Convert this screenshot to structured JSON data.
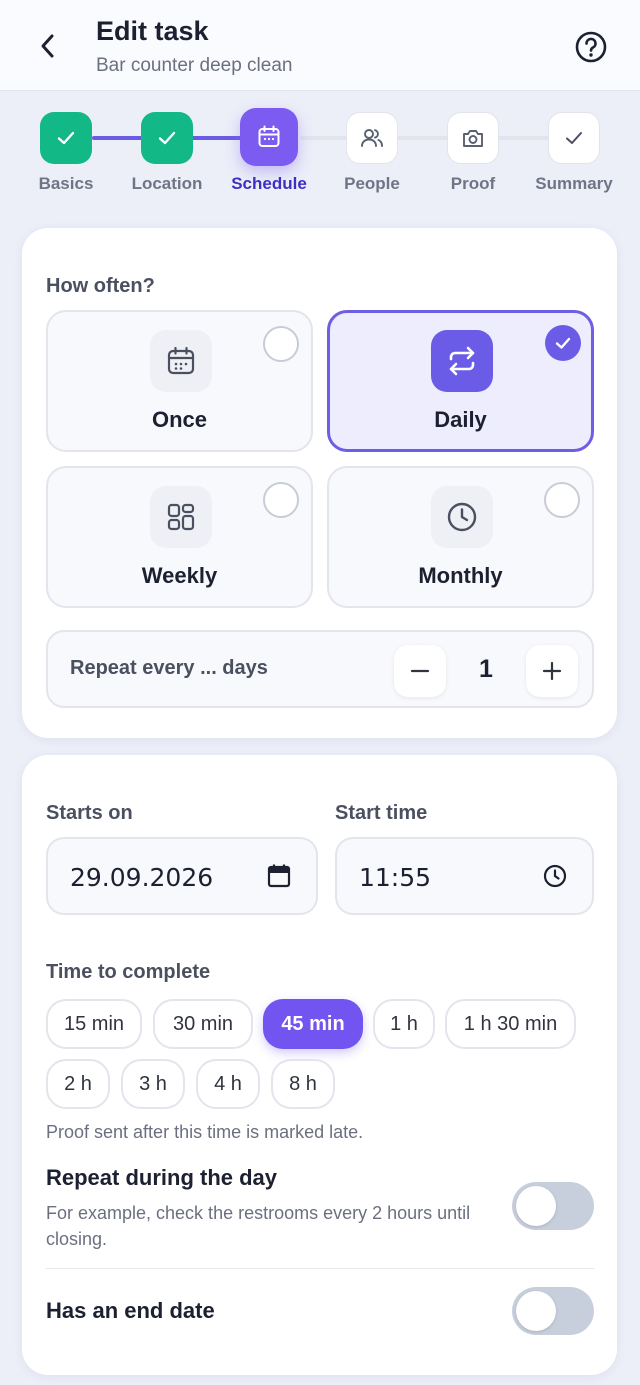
{
  "header": {
    "title": "Edit task",
    "subtitle": "Bar counter deep clean"
  },
  "stepper": {
    "steps": [
      {
        "label": "Basics",
        "state": "done",
        "icon": "check-icon"
      },
      {
        "label": "Location",
        "state": "done",
        "icon": "check-icon"
      },
      {
        "label": "Schedule",
        "state": "active",
        "icon": "calendar-icon"
      },
      {
        "label": "People",
        "state": "todo",
        "icon": "people-icon"
      },
      {
        "label": "Proof",
        "state": "todo",
        "icon": "camera-icon"
      },
      {
        "label": "Summary",
        "state": "todo",
        "icon": "check-icon"
      }
    ]
  },
  "frequency": {
    "label": "How often?",
    "options": [
      {
        "label": "Once",
        "icon": "calendar-icon",
        "selected": false
      },
      {
        "label": "Daily",
        "icon": "repeat-icon",
        "selected": true
      },
      {
        "label": "Weekly",
        "icon": "grid-icon",
        "selected": false
      },
      {
        "label": "Monthly",
        "icon": "clock-icon",
        "selected": false
      }
    ],
    "repeat_label": "Repeat every ... days",
    "repeat_value": "1",
    "minus": "−",
    "plus": "+"
  },
  "schedule": {
    "starts_on_label": "Starts on",
    "starts_on_value": "29.09.2026",
    "start_time_label": "Start time",
    "start_time_value": "11:55",
    "time_to_complete_label": "Time to complete",
    "durations": [
      {
        "label": "15 min",
        "selected": false
      },
      {
        "label": "30 min",
        "selected": false
      },
      {
        "label": "45 min",
        "selected": true
      },
      {
        "label": "1 h",
        "selected": false
      },
      {
        "label": "1 h 30 min",
        "selected": false
      },
      {
        "label": "2 h",
        "selected": false
      },
      {
        "label": "3 h",
        "selected": false
      },
      {
        "label": "4 h",
        "selected": false
      },
      {
        "label": "8 h",
        "selected": false
      }
    ],
    "late_note": "Proof sent after this time is marked late.",
    "repeat_day_label": "Repeat during the day",
    "repeat_day_desc": "For example, check the restrooms every 2 hours until closing.",
    "repeat_day_on": false,
    "end_date_label": "Has an end date",
    "end_date_on": false
  },
  "colors": {
    "accent": "#7c5cf0",
    "done": "#12b886"
  }
}
